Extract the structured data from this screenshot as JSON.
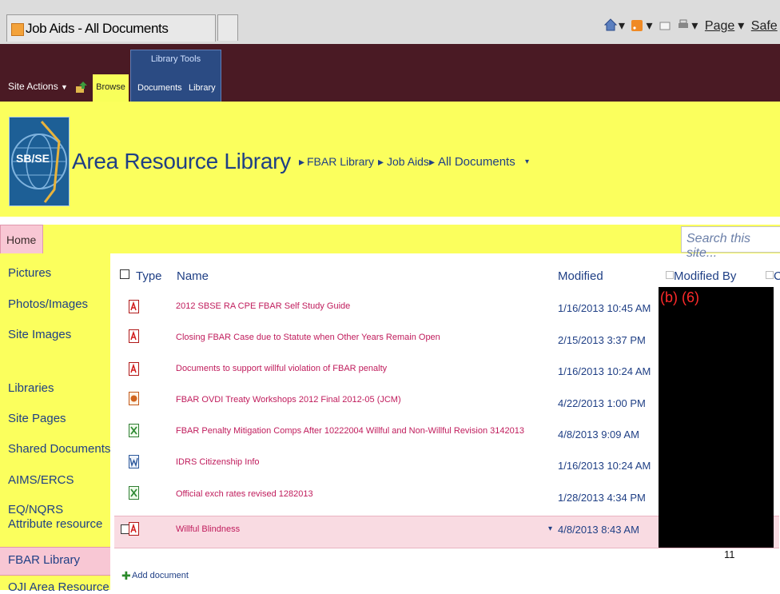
{
  "browser": {
    "tab_title": "Job Aids - All Documents",
    "commands": {
      "page": "Page",
      "safety": "Safe"
    }
  },
  "ribbon": {
    "site_actions": "Site Actions",
    "browse": "Browse",
    "library_tools": "Library Tools",
    "documents": "Documents",
    "library": "Library"
  },
  "header": {
    "logo_text": "SB/SE",
    "site_title": "Area Resource Library",
    "breadcrumb": [
      "FBAR Library",
      "Job Aids",
      "All Documents"
    ]
  },
  "topnav": {
    "home": "Home",
    "search_placeholder": "Search this site..."
  },
  "leftnav": {
    "items": [
      "Pictures",
      "Photos/Images",
      "Site Images",
      "Libraries",
      "Site Pages",
      "Shared Documents",
      "AIMS/ERCS",
      "EQ/NQRS Attribute resource",
      "FBAR Library",
      "OJI Area Resource"
    ]
  },
  "list": {
    "headers": {
      "type": "Type",
      "name": "Name",
      "modified": "Modified",
      "modified_by": "Modified By",
      "checked_out": "C"
    },
    "rows": [
      {
        "type": "pdf",
        "name": "2012 SBSE RA CPE FBAR Self Study Guide",
        "modified": "1/16/2013 10:45 AM"
      },
      {
        "type": "pdf",
        "name": "Closing FBAR Case due to Statute when Other Years Remain Open",
        "modified": "2/15/2013 3:37 PM"
      },
      {
        "type": "pdf",
        "name": "Documents to support willful violation of FBAR penalty",
        "modified": "1/16/2013 10:24 AM"
      },
      {
        "type": "ppt",
        "name": "FBAR OVDI Treaty Workshops 2012 Final 2012-05 (JCM)",
        "modified": "4/22/2013 1:00 PM"
      },
      {
        "type": "xls",
        "name": "FBAR Penalty Mitigation Comps After 10222004 Willful and Non-Willful Revision 3142013",
        "modified": "4/8/2013 9:09 AM"
      },
      {
        "type": "doc",
        "name": "IDRS Citizenship Info",
        "modified": "1/16/2013 10:24 AM"
      },
      {
        "type": "xls",
        "name": "Official exch rates revised 1282013",
        "modified": "1/28/2013 4:34 PM"
      },
      {
        "type": "pdf",
        "name": "Willful Blindness",
        "modified": "4/8/2013 8:43 AM"
      }
    ],
    "add_document": "Add document"
  },
  "redaction": "(b) (6)",
  "page_number": "11"
}
